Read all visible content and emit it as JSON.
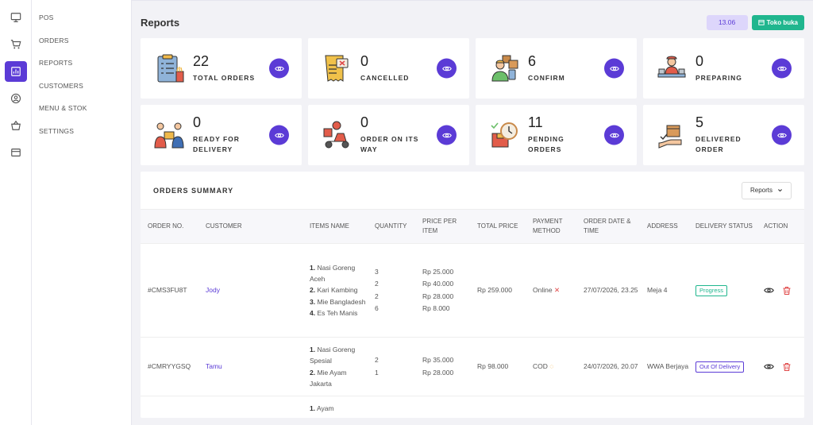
{
  "rail": [
    "monitor-icon",
    "cart-icon",
    "reports-icon",
    "customers-icon",
    "basket-icon",
    "settings-icon"
  ],
  "menu": {
    "items": [
      "POS",
      "ORDERS",
      "REPORTS",
      "CUSTOMERS",
      "MENU & STOK",
      "SETTINGS"
    ]
  },
  "header": {
    "title": "Reports",
    "time": "13.06",
    "store_status": "Toko buka"
  },
  "cards": [
    {
      "count": "22",
      "label": "TOTAL ORDERS"
    },
    {
      "count": "0",
      "label": "CANCELLED"
    },
    {
      "count": "6",
      "label": "CONFIRM"
    },
    {
      "count": "0",
      "label": "PREPARING"
    },
    {
      "count": "0",
      "label": "READY FOR DELIVERY"
    },
    {
      "count": "0",
      "label": "ORDER ON ITS WAY"
    },
    {
      "count": "11",
      "label": "PENDING ORDERS"
    },
    {
      "count": "5",
      "label": "DELIVERED ORDER"
    }
  ],
  "summary": {
    "title": "ORDERS SUMMARY",
    "dropdown": "Reports",
    "columns": [
      "ORDER NO.",
      "CUSTOMER",
      "ITEMS NAME",
      "QUANTITY",
      "PRICE PER ITEM",
      "TOTAL PRICE",
      "PAYMENT METHOD",
      "ORDER DATE & TIME",
      "ADDRESS",
      "DELIVERY STATUS",
      "ACTION"
    ],
    "rows": [
      {
        "order_no": "#CMS3FU8T",
        "customer": "Jody",
        "items": [
          {
            "n": "1.",
            "name": "Nasi Goreng Aceh"
          },
          {
            "n": "2.",
            "name": "Kari Kambing"
          },
          {
            "n": "3.",
            "name": "Mie Bangladesh"
          },
          {
            "n": "4.",
            "name": "Es Teh Manis"
          }
        ],
        "quantities": [
          "3",
          "2",
          "2",
          "6"
        ],
        "prices": [
          "Rp 25.000",
          "Rp 40.000",
          "Rp 28.000",
          "Rp 8.000"
        ],
        "total": "Rp 259.000",
        "payment": "Online",
        "date": "27/07/2026, 23.25",
        "address": "Meja 4",
        "status": "Progress"
      },
      {
        "order_no": "#CMRYYGSQ",
        "customer": "Tamu",
        "items": [
          {
            "n": "1.",
            "name": "Nasi Goreng Spesial"
          },
          {
            "n": "2.",
            "name": "Mie Ayam Jakarta"
          }
        ],
        "quantities": [
          "2",
          "1"
        ],
        "prices": [
          "Rp 35.000",
          "Rp 28.000"
        ],
        "total": "Rp 98.000",
        "payment": "COD",
        "date": "24/07/2026, 20.07",
        "address": "WWA Berjaya",
        "status": "Out Of Delivery"
      },
      {
        "order_no": "",
        "customer": "",
        "items": [
          {
            "n": "1.",
            "name": "Ayam"
          }
        ],
        "quantities": [],
        "prices": [],
        "total": "",
        "payment": "",
        "date": "",
        "address": "",
        "status": ""
      }
    ]
  },
  "colors": {
    "accent": "#5b3bd6",
    "green": "#20b68e",
    "red": "#e04848"
  }
}
